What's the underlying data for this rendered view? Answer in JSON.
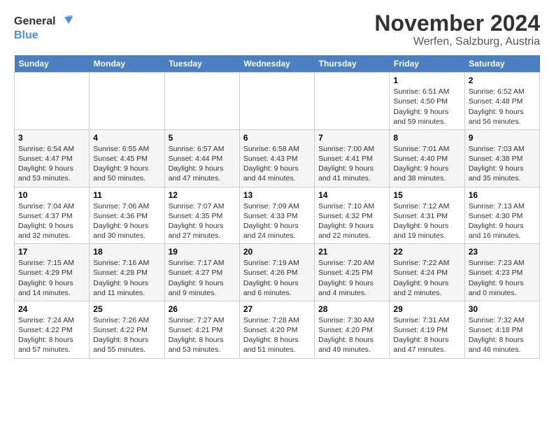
{
  "logo": {
    "line1": "General",
    "line2": "Blue"
  },
  "title": "November 2024",
  "subtitle": "Werfen, Salzburg, Austria",
  "days_of_week": [
    "Sunday",
    "Monday",
    "Tuesday",
    "Wednesday",
    "Thursday",
    "Friday",
    "Saturday"
  ],
  "weeks": [
    [
      {
        "day": "",
        "info": ""
      },
      {
        "day": "",
        "info": ""
      },
      {
        "day": "",
        "info": ""
      },
      {
        "day": "",
        "info": ""
      },
      {
        "day": "",
        "info": ""
      },
      {
        "day": "1",
        "info": "Sunrise: 6:51 AM\nSunset: 4:50 PM\nDaylight: 9 hours and 59 minutes."
      },
      {
        "day": "2",
        "info": "Sunrise: 6:52 AM\nSunset: 4:48 PM\nDaylight: 9 hours and 56 minutes."
      }
    ],
    [
      {
        "day": "3",
        "info": "Sunrise: 6:54 AM\nSunset: 4:47 PM\nDaylight: 9 hours and 53 minutes."
      },
      {
        "day": "4",
        "info": "Sunrise: 6:55 AM\nSunset: 4:45 PM\nDaylight: 9 hours and 50 minutes."
      },
      {
        "day": "5",
        "info": "Sunrise: 6:57 AM\nSunset: 4:44 PM\nDaylight: 9 hours and 47 minutes."
      },
      {
        "day": "6",
        "info": "Sunrise: 6:58 AM\nSunset: 4:43 PM\nDaylight: 9 hours and 44 minutes."
      },
      {
        "day": "7",
        "info": "Sunrise: 7:00 AM\nSunset: 4:41 PM\nDaylight: 9 hours and 41 minutes."
      },
      {
        "day": "8",
        "info": "Sunrise: 7:01 AM\nSunset: 4:40 PM\nDaylight: 9 hours and 38 minutes."
      },
      {
        "day": "9",
        "info": "Sunrise: 7:03 AM\nSunset: 4:38 PM\nDaylight: 9 hours and 35 minutes."
      }
    ],
    [
      {
        "day": "10",
        "info": "Sunrise: 7:04 AM\nSunset: 4:37 PM\nDaylight: 9 hours and 32 minutes."
      },
      {
        "day": "11",
        "info": "Sunrise: 7:06 AM\nSunset: 4:36 PM\nDaylight: 9 hours and 30 minutes."
      },
      {
        "day": "12",
        "info": "Sunrise: 7:07 AM\nSunset: 4:35 PM\nDaylight: 9 hours and 27 minutes."
      },
      {
        "day": "13",
        "info": "Sunrise: 7:09 AM\nSunset: 4:33 PM\nDaylight: 9 hours and 24 minutes."
      },
      {
        "day": "14",
        "info": "Sunrise: 7:10 AM\nSunset: 4:32 PM\nDaylight: 9 hours and 22 minutes."
      },
      {
        "day": "15",
        "info": "Sunrise: 7:12 AM\nSunset: 4:31 PM\nDaylight: 9 hours and 19 minutes."
      },
      {
        "day": "16",
        "info": "Sunrise: 7:13 AM\nSunset: 4:30 PM\nDaylight: 9 hours and 16 minutes."
      }
    ],
    [
      {
        "day": "17",
        "info": "Sunrise: 7:15 AM\nSunset: 4:29 PM\nDaylight: 9 hours and 14 minutes."
      },
      {
        "day": "18",
        "info": "Sunrise: 7:16 AM\nSunset: 4:28 PM\nDaylight: 9 hours and 11 minutes."
      },
      {
        "day": "19",
        "info": "Sunrise: 7:17 AM\nSunset: 4:27 PM\nDaylight: 9 hours and 9 minutes."
      },
      {
        "day": "20",
        "info": "Sunrise: 7:19 AM\nSunset: 4:26 PM\nDaylight: 9 hours and 6 minutes."
      },
      {
        "day": "21",
        "info": "Sunrise: 7:20 AM\nSunset: 4:25 PM\nDaylight: 9 hours and 4 minutes."
      },
      {
        "day": "22",
        "info": "Sunrise: 7:22 AM\nSunset: 4:24 PM\nDaylight: 9 hours and 2 minutes."
      },
      {
        "day": "23",
        "info": "Sunrise: 7:23 AM\nSunset: 4:23 PM\nDaylight: 9 hours and 0 minutes."
      }
    ],
    [
      {
        "day": "24",
        "info": "Sunrise: 7:24 AM\nSunset: 4:22 PM\nDaylight: 8 hours and 57 minutes."
      },
      {
        "day": "25",
        "info": "Sunrise: 7:26 AM\nSunset: 4:22 PM\nDaylight: 8 hours and 55 minutes."
      },
      {
        "day": "26",
        "info": "Sunrise: 7:27 AM\nSunset: 4:21 PM\nDaylight: 8 hours and 53 minutes."
      },
      {
        "day": "27",
        "info": "Sunrise: 7:28 AM\nSunset: 4:20 PM\nDaylight: 8 hours and 51 minutes."
      },
      {
        "day": "28",
        "info": "Sunrise: 7:30 AM\nSunset: 4:20 PM\nDaylight: 8 hours and 49 minutes."
      },
      {
        "day": "29",
        "info": "Sunrise: 7:31 AM\nSunset: 4:19 PM\nDaylight: 8 hours and 47 minutes."
      },
      {
        "day": "30",
        "info": "Sunrise: 7:32 AM\nSunset: 4:18 PM\nDaylight: 8 hours and 46 minutes."
      }
    ]
  ]
}
